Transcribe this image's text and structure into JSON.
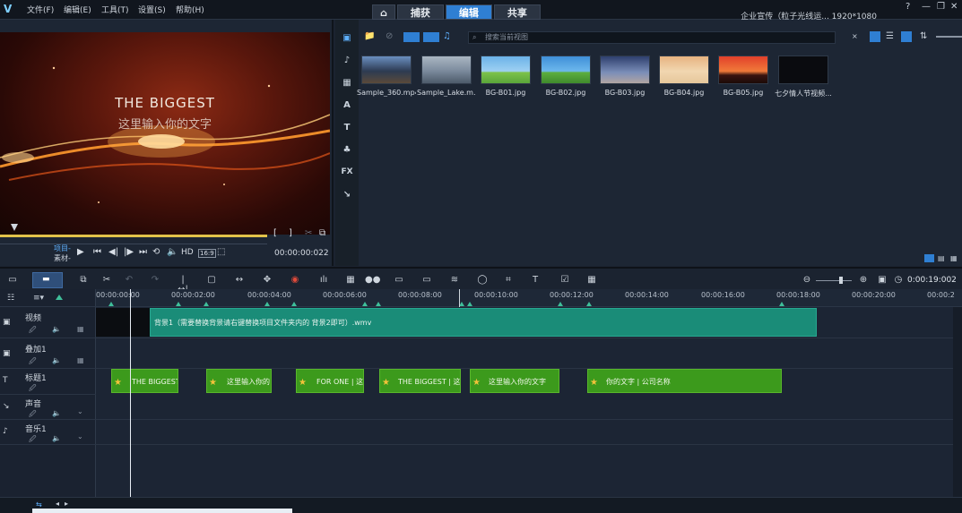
{
  "menu": {
    "file": "文件(F)",
    "edit": "编辑(E)",
    "tools": "工具(T)",
    "settings": "设置(S)",
    "help": "帮助(H)"
  },
  "mode_tabs": {
    "capture": "捕获",
    "edit": "编辑",
    "share": "共享"
  },
  "project_title": "企业宣传（粒子光线运... 1920*1080",
  "preview": {
    "title": "THE BIGGEST",
    "subtitle": "这里输入你的文字",
    "project_label": "项目-",
    "clip_label": "素材-",
    "hd": "HD",
    "ratio": "16:9",
    "timecode": "00:00:00:022",
    "scrub_fraction": 0.81
  },
  "library": {
    "search_placeholder": "搜索当前视图",
    "items": [
      {
        "label": "Sample_360.mp4"
      },
      {
        "label": "Sample_Lake.m..."
      },
      {
        "label": "BG-B01.jpg"
      },
      {
        "label": "BG-B02.jpg"
      },
      {
        "label": "BG-B03.jpg"
      },
      {
        "label": "BG-B04.jpg"
      },
      {
        "label": "BG-B05.jpg"
      },
      {
        "label": "七夕情人节视频..."
      }
    ],
    "side_icons": [
      "media-icon",
      "instant-project-icon",
      "transition-icon",
      "title-icon",
      "graphics-icon",
      "fx-icon",
      "path-icon"
    ]
  },
  "timeline": {
    "timecode": "0:00:19:002",
    "ruler": [
      "00:00:00:00",
      "00:00:02:00",
      "00:00:04:00",
      "00:00:06:00",
      "00:00:08:00",
      "00:00:10:00",
      "00:00:12:00",
      "00:00:14:00",
      "00:00:16:00",
      "00:00:18:00",
      "00:00:20:00",
      "00:00:2"
    ],
    "tracks": [
      {
        "name": "视频"
      },
      {
        "name": "叠加1"
      },
      {
        "name": "标题1"
      },
      {
        "name": "声音"
      },
      {
        "name": "音乐1"
      }
    ],
    "video_clip": "背景1（需要替换背景请右键替换项目文件夹内的 背景2即可）.wmv",
    "title_clips": [
      "THE BIGGEST |",
      "这里输入你的",
      "FOR ONE | 这里",
      "THE BIGGEST | 这里",
      "这里输入你的文字",
      "你的文字 | 公司名称"
    ]
  },
  "colors": {
    "accent": "#2f7fd3",
    "video_clip": "#1a8c78",
    "title_clip": "#3c9a1c",
    "scrub": "#e2c24a"
  }
}
